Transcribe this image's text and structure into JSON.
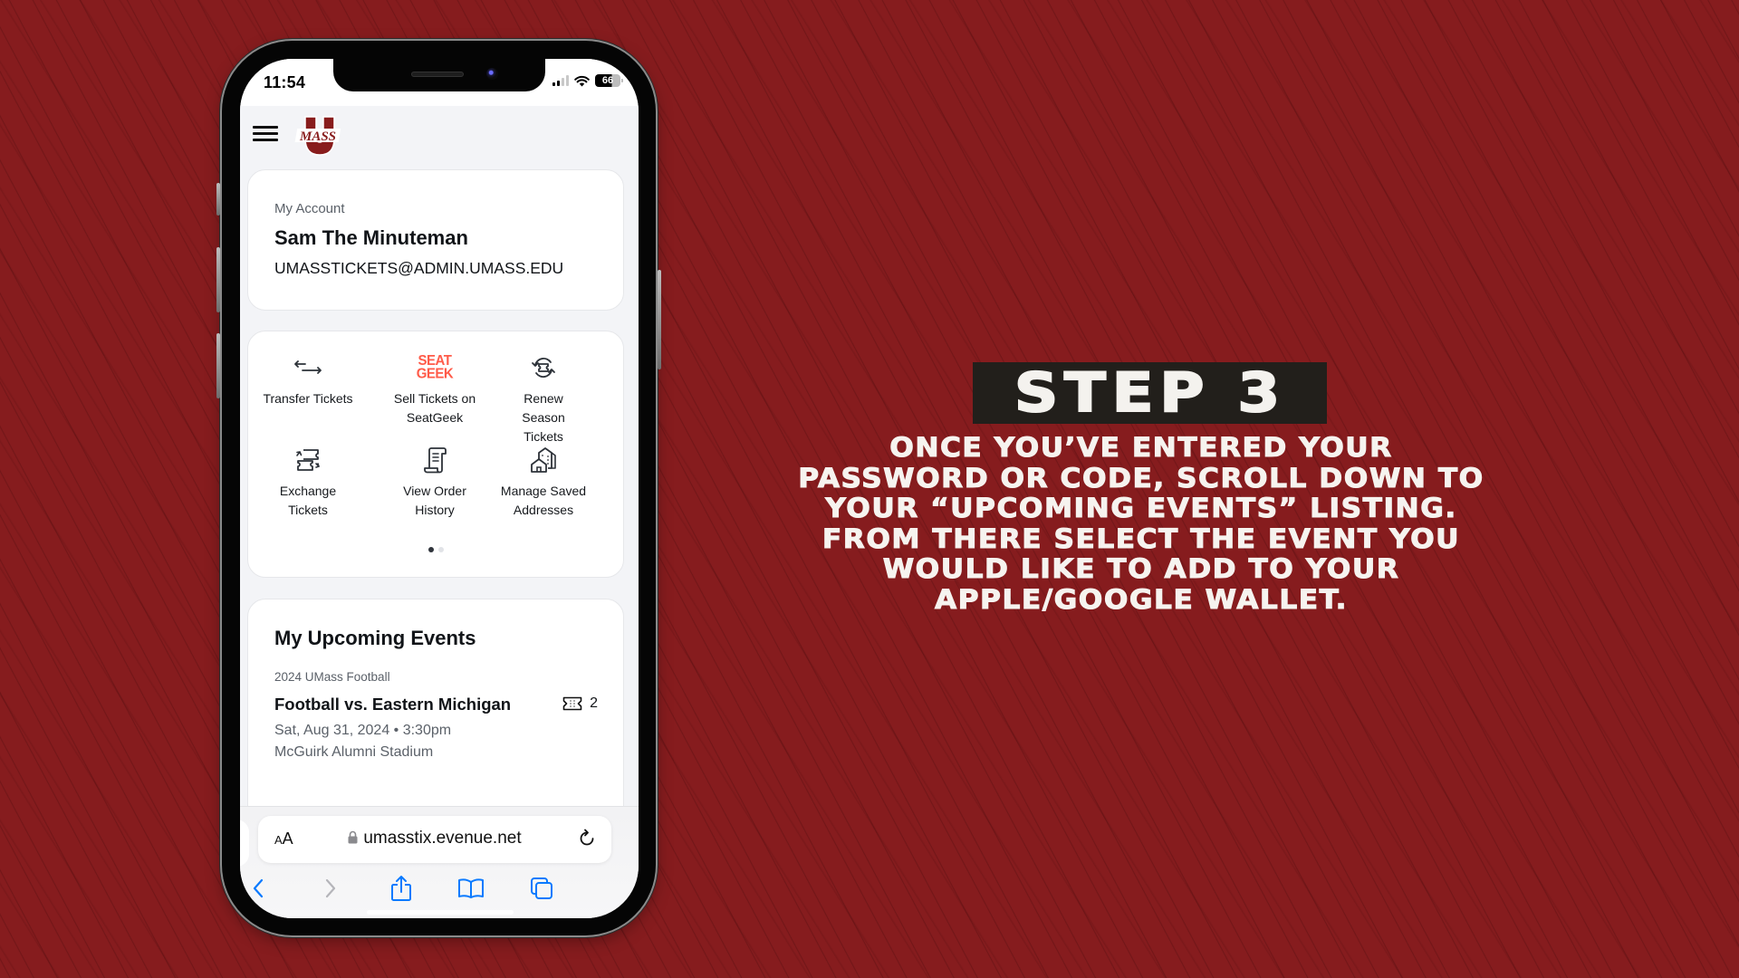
{
  "phone": {
    "status_bar": {
      "time": "11:54",
      "battery": "66",
      "icons": [
        "signal-icon",
        "wifi-icon",
        "battery-icon"
      ]
    },
    "header": {
      "menu_icon": "hamburger-menu-icon",
      "logo": "UMass",
      "logo_colors": {
        "maroon": "#881c1c",
        "white": "#ffffff"
      }
    },
    "account": {
      "label": "My Account",
      "name": "Sam The Minuteman",
      "email": "UMASSTICKETS@ADMIN.UMASS.EDU"
    },
    "actions": [
      {
        "label": "Transfer Tickets",
        "icon": "transfer-arrows-icon"
      },
      {
        "label": "Sell Tickets on SeatGeek",
        "icon": "seatgeek-logo",
        "logo_text_1": "SEAT",
        "logo_text_2": "GEEK",
        "color": "#ff5b49"
      },
      {
        "label": "Renew Season Tickets",
        "icon": "renew-ticket-icon"
      },
      {
        "label": "Exchange Tickets",
        "icon": "exchange-tickets-icon"
      },
      {
        "label": "View Order History",
        "icon": "order-scroll-icon"
      },
      {
        "label": "Manage Saved Addresses",
        "icon": "buildings-icon"
      }
    ],
    "carousel": {
      "pages": 2,
      "active": 1
    },
    "upcoming": {
      "title": "My Upcoming Events",
      "events": [
        {
          "series": "2024 UMass Football",
          "name": "Football vs. Eastern Michigan",
          "ticket_count": "2",
          "date": "Sat, Aug 31, 2024 • 3:30pm",
          "venue": "McGuirk Alumni Stadium"
        }
      ]
    },
    "safari": {
      "text_size_label": "AA",
      "url": "umasstix.evenue.net",
      "toolbar": [
        "back-icon",
        "forward-icon",
        "share-icon",
        "bookmarks-icon",
        "tabs-icon"
      ],
      "accent": "#0a7aff"
    }
  },
  "instructions": {
    "step_label": "STEP 3",
    "lines": [
      "ONCE YOU’VE ENTERED YOUR",
      "PASSWORD OR CODE, SCROLL DOWN TO",
      "YOUR “UPCOMING EVENTS” LISTING.",
      "FROM THERE SELECT THE EVENT YOU",
      "WOULD LIKE TO ADD TO YOUR",
      "APPLE/GOOGLE WALLET."
    ]
  },
  "colors": {
    "background": "#861c1e",
    "step_box": "#221f1b",
    "text": "#f6f3ef"
  }
}
